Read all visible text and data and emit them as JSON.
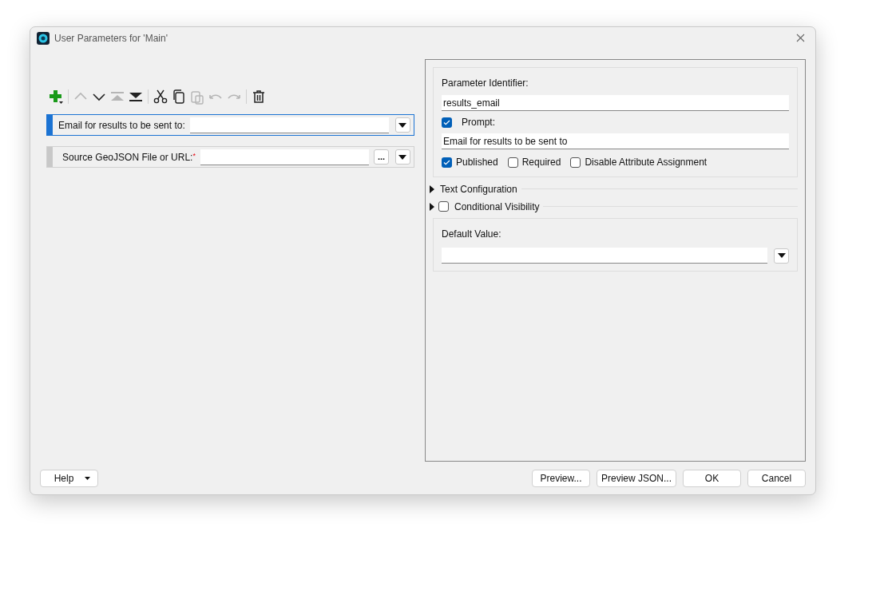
{
  "window": {
    "title": "User Parameters for 'Main'"
  },
  "toolbar": [
    [
      {
        "kind": "add",
        "disabled": false
      }
    ],
    [
      {
        "kind": "move-up",
        "disabled": true
      },
      {
        "kind": "move-down",
        "disabled": false
      },
      {
        "kind": "move-top",
        "disabled": true
      },
      {
        "kind": "move-bottom",
        "disabled": false
      }
    ],
    [
      {
        "kind": "cut",
        "disabled": false
      },
      {
        "kind": "copy",
        "disabled": false
      },
      {
        "kind": "paste",
        "disabled": true
      },
      {
        "kind": "undo",
        "disabled": true
      },
      {
        "kind": "redo",
        "disabled": true
      }
    ],
    [
      {
        "kind": "delete",
        "disabled": false
      }
    ]
  ],
  "parameters": [
    {
      "label": "Email for results to be sent to:",
      "selected": true
    },
    {
      "label": "Source GeoJSON File or URL:$^{*}$",
      "selected": false,
      "browse_label": "..."
    }
  ],
  "details": {
    "identifier_label": "Parameter Identifier:",
    "identifier_value": "results_email",
    "prompt": {
      "label": "Prompt:",
      "checked": true,
      "value": "Email for results to be sent to"
    },
    "options": [
      {
        "label": "Published",
        "checked": true
      },
      {
        "label": "Required",
        "checked": false
      },
      {
        "label": "Disable Attribute Assignment",
        "checked": false
      }
    ],
    "sections": [
      {
        "label": "Text Configuration",
        "expanded": false
      },
      {
        "label": "Conditional Visibility",
        "expanded": false,
        "checked": false
      }
    ],
    "default_value_label": "Default Value:"
  },
  "footer": {
    "help": "Help",
    "buttons": [
      "Preview...",
      "Preview JSON...",
      "OK",
      "Cancel"
    ]
  }
}
